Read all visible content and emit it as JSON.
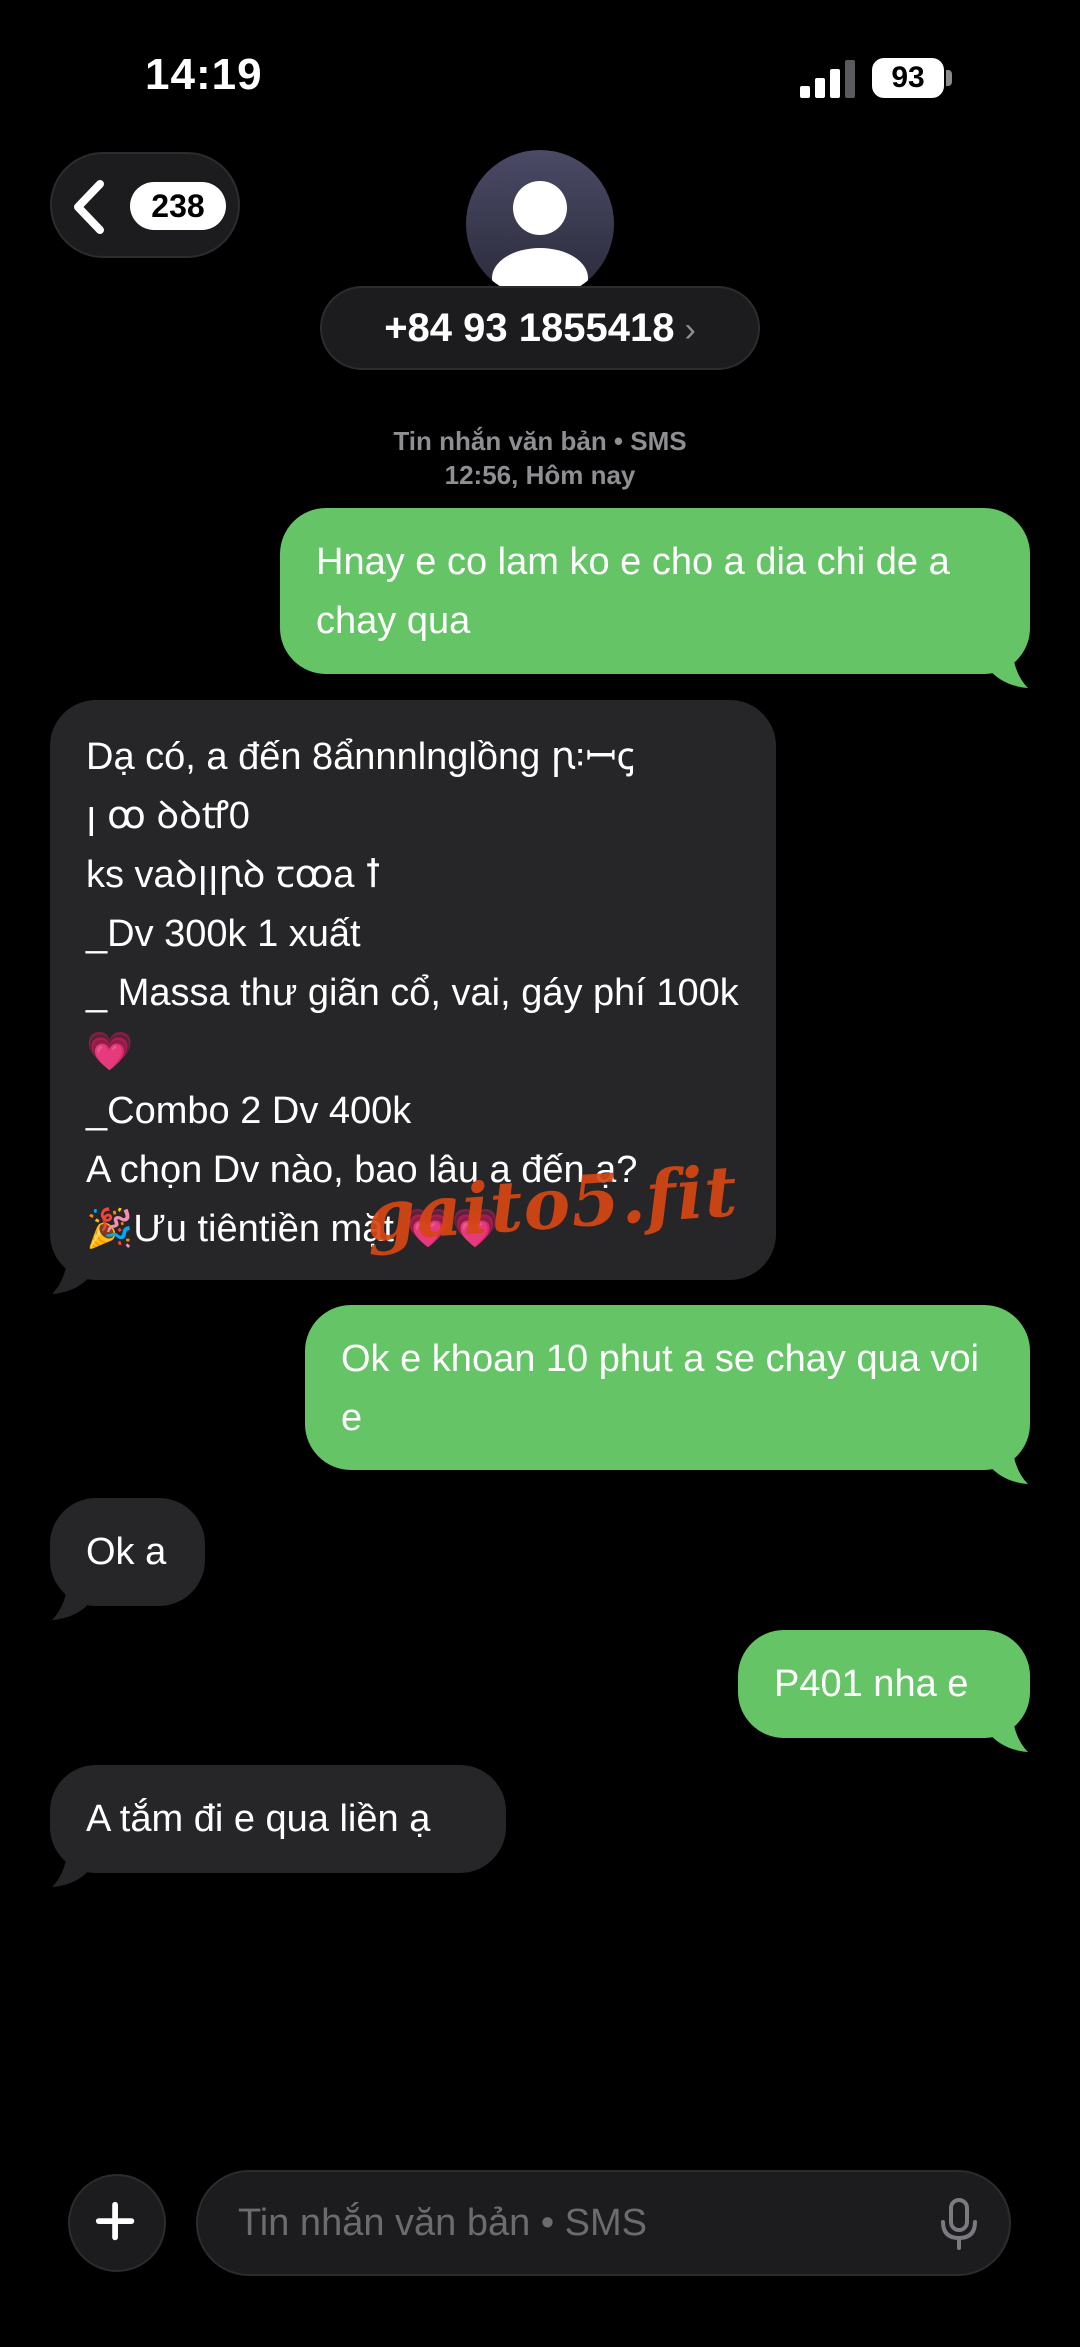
{
  "status_bar": {
    "time": "14:19",
    "battery": "93"
  },
  "header": {
    "back_count": "238",
    "contact_number": "+84 93 1855418",
    "chevron": "›"
  },
  "conversation": {
    "timestamp_line1": "Tin nhắn văn bản • SMS",
    "timestamp_line2": "12:56, Hôm nay",
    "messages": [
      {
        "direction": "sent",
        "text": "Hnay e co lam ko e cho a dia chi de a chay qua"
      },
      {
        "direction": "received",
        "text": "Dạ có, a đến 8ẩnnnlnglồng ꞃ꞉ꟷꞔ\nꞁ ꝏ ꝺꝺꝷ0\nks vaꝺꞁꞁꞃꝺ ꞇꝏa ꝉ\n_Dv 300k 1 xuất\n_ Massa thư giãn cổ, vai, gáy phí 100k 💗\n_Combo 2 Dv 400k\nA chọn Dv nào, bao lâu a đến ạ?\n🎉Ưu tiêntiền mặt 💗💗"
      },
      {
        "direction": "sent",
        "text": "Ok e khoan 10 phut a se chay qua voi e"
      },
      {
        "direction": "received",
        "text": "Ok a"
      },
      {
        "direction": "sent",
        "text": "P401 nha e"
      },
      {
        "direction": "received",
        "text": "A tắm đi e qua liền ạ"
      }
    ]
  },
  "watermark": "gaito5.fit",
  "composer": {
    "placeholder": "Tin nhắn văn bản • SMS"
  },
  "colors": {
    "sent_bubble": "#65c466",
    "received_bubble": "#262628",
    "background": "#000000"
  },
  "icons": {
    "back": "chevron-left-icon",
    "avatar": "person-icon",
    "plus": "plus-icon",
    "mic": "microphone-icon",
    "signal": "signal-icon"
  }
}
